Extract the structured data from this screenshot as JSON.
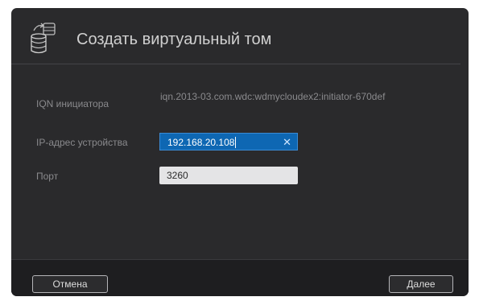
{
  "dialog": {
    "title": "Создать виртуальный том",
    "header_icon": "database-icon"
  },
  "form": {
    "iqn": {
      "label": "IQN инициатора",
      "value": "iqn.2013-03.com.wdc:wdmycloudex2:initiator-670def"
    },
    "ip": {
      "label": "IP-адрес устройства",
      "value": "192.168.20.108"
    },
    "port": {
      "label": "Порт",
      "value": "3260"
    }
  },
  "footer": {
    "cancel_label": "Отмена",
    "next_label": "Далее"
  },
  "colors": {
    "dialog_bg": "#2a2a2c",
    "accent": "#0e67b3",
    "label_text": "#8a8a8d"
  }
}
